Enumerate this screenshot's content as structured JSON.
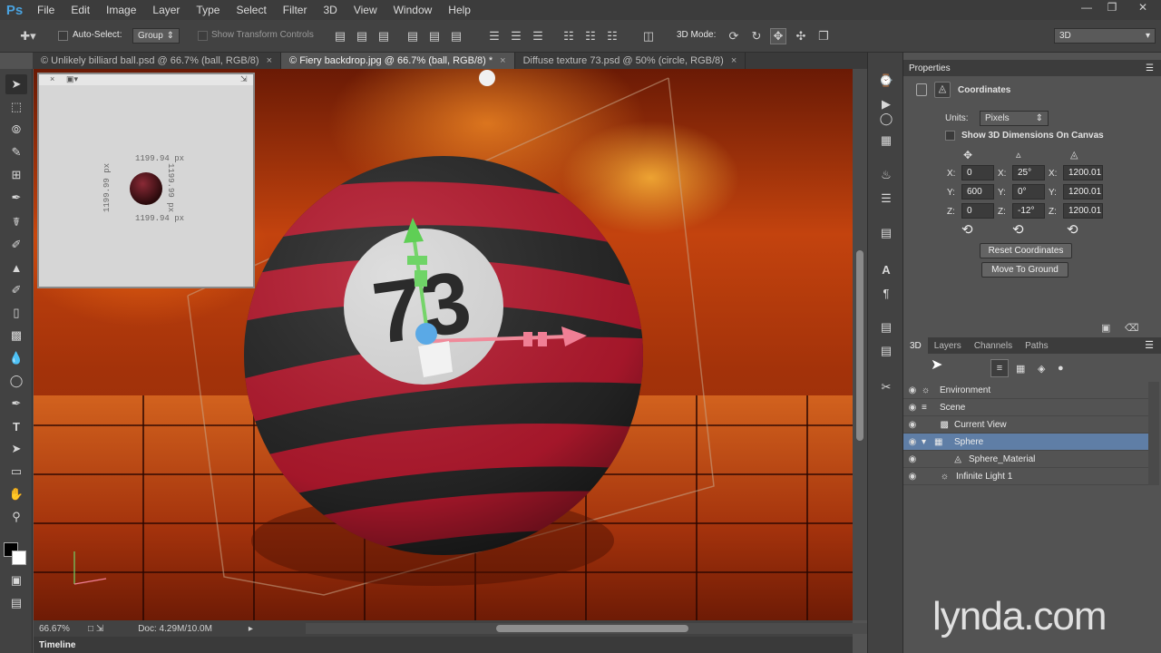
{
  "app": {
    "logo": "Ps"
  },
  "menu": [
    "File",
    "Edit",
    "Image",
    "Layer",
    "Type",
    "Select",
    "Filter",
    "3D",
    "View",
    "Window",
    "Help"
  ],
  "options": {
    "auto_select_label": "Auto-Select:",
    "auto_select_value": "Group",
    "transform_label": "Show Transform Controls",
    "mode_label": "3D Mode:",
    "workspace": "3D"
  },
  "tabs": [
    {
      "label": "© Unlikely billiard ball.psd @ 66.7% (ball, RGB/8)"
    },
    {
      "label": "© Fiery backdrop.jpg @ 66.7% (ball, RGB/8) *"
    },
    {
      "label": "Diffuse texture 73.psd @ 50% (circle, RGB/8)"
    }
  ],
  "ball": {
    "number": "73"
  },
  "secondary_view": {
    "dim_top": "1199.94 px",
    "dim_bottom": "1199.94 px",
    "dim_left": "1199.99 px",
    "dim_right": "1199.99 px"
  },
  "status": {
    "zoom": "66.67%",
    "doc": "Doc: 4.29M/10.0M"
  },
  "timeline": "Timeline",
  "properties": {
    "title": "Properties",
    "section": "Coordinates",
    "units_label": "Units:",
    "units_value": "Pixels",
    "show_dims_label": "Show 3D Dimensions On Canvas",
    "pos": {
      "x": "0",
      "y": "600",
      "z": "0"
    },
    "rot": {
      "x": "25°",
      "y": "0°",
      "z": "-12°"
    },
    "scale": {
      "x": "1200.01",
      "y": "1200.01",
      "z": "1200.01"
    },
    "reset_label": "Reset Coordinates",
    "ground_label": "Move To Ground"
  },
  "layer_tabs": [
    "3D",
    "Layers",
    "Channels",
    "Paths"
  ],
  "scene": [
    {
      "name": "Environment"
    },
    {
      "name": "Scene"
    },
    {
      "name": "Current View"
    },
    {
      "name": "Sphere"
    },
    {
      "name": "Sphere_Material"
    },
    {
      "name": "Infinite Light 1"
    }
  ],
  "watermark": "lynda.com"
}
